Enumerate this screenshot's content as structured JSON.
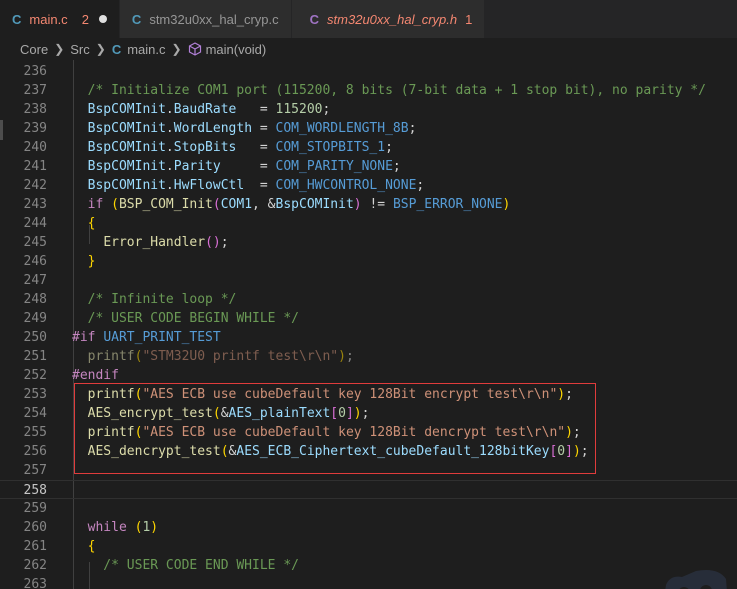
{
  "tabs": [
    {
      "icon": "C",
      "label": "main.c",
      "badge": "2",
      "dirty": true,
      "active": true
    },
    {
      "icon": "C",
      "label": "stm32u0xx_hal_cryp.c",
      "active": false
    },
    {
      "icon": "C",
      "label": "stm32u0xx_hal_cryp.h",
      "badge": "1",
      "active": false
    }
  ],
  "breadcrumb": {
    "items": [
      "Core",
      "Src",
      "main.c",
      "main(void)"
    ]
  },
  "editor": {
    "current_line": "258",
    "lines": [
      {
        "n": "236",
        "tokens": []
      },
      {
        "n": "237",
        "tokens": [
          {
            "t": "  /* Initialize COM1 port (115200, 8 bits (7-bit data + 1 stop bit), no parity */",
            "c": "cmt"
          }
        ]
      },
      {
        "n": "238",
        "tokens": [
          {
            "t": "  BspCOMInit",
            "c": "var"
          },
          {
            "t": "."
          },
          {
            "t": "BaudRate",
            "c": "var"
          },
          {
            "t": "   = "
          },
          {
            "t": "115200",
            "c": "num"
          },
          {
            "t": ";"
          }
        ]
      },
      {
        "n": "239",
        "tokens": [
          {
            "t": "  BspCOMInit",
            "c": "var"
          },
          {
            "t": "."
          },
          {
            "t": "WordLength",
            "c": "var"
          },
          {
            "t": " = "
          },
          {
            "t": "COM_WORDLENGTH_8B",
            "c": "mac"
          },
          {
            "t": ";"
          }
        ]
      },
      {
        "n": "240",
        "tokens": [
          {
            "t": "  BspCOMInit",
            "c": "var"
          },
          {
            "t": "."
          },
          {
            "t": "StopBits",
            "c": "var"
          },
          {
            "t": "   = "
          },
          {
            "t": "COM_STOPBITS_1",
            "c": "mac"
          },
          {
            "t": ";"
          }
        ]
      },
      {
        "n": "241",
        "tokens": [
          {
            "t": "  BspCOMInit",
            "c": "var"
          },
          {
            "t": "."
          },
          {
            "t": "Parity",
            "c": "var"
          },
          {
            "t": "     = "
          },
          {
            "t": "COM_PARITY_NONE",
            "c": "mac"
          },
          {
            "t": ";"
          }
        ]
      },
      {
        "n": "242",
        "tokens": [
          {
            "t": "  BspCOMInit",
            "c": "var"
          },
          {
            "t": "."
          },
          {
            "t": "HwFlowCtl",
            "c": "var"
          },
          {
            "t": "  = "
          },
          {
            "t": "COM_HWCONTROL_NONE",
            "c": "mac"
          },
          {
            "t": ";"
          }
        ]
      },
      {
        "n": "243",
        "tokens": [
          {
            "t": "  if",
            "c": "kc"
          },
          {
            "t": " "
          },
          {
            "t": "(",
            "c": "br1"
          },
          {
            "t": "BSP_COM_Init",
            "c": "fn"
          },
          {
            "t": "(",
            "c": "br2"
          },
          {
            "t": "COM1",
            "c": "var"
          },
          {
            "t": ", &"
          },
          {
            "t": "BspCOMInit",
            "c": "var"
          },
          {
            "t": ")",
            "c": "br2"
          },
          {
            "t": " != "
          },
          {
            "t": "BSP_ERROR_NONE",
            "c": "mac"
          },
          {
            "t": ")",
            "c": "br1"
          }
        ]
      },
      {
        "n": "244",
        "tokens": [
          {
            "t": "  "
          },
          {
            "t": "{",
            "c": "br1"
          }
        ]
      },
      {
        "n": "245",
        "tokens": [
          {
            "t": "    "
          },
          {
            "t": "Error_Handler",
            "c": "fn"
          },
          {
            "t": "(",
            "c": "br2"
          },
          {
            "t": ")",
            "c": "br2"
          },
          {
            "t": ";"
          }
        ]
      },
      {
        "n": "246",
        "tokens": [
          {
            "t": "  "
          },
          {
            "t": "}",
            "c": "br1"
          }
        ]
      },
      {
        "n": "247",
        "tokens": []
      },
      {
        "n": "248",
        "tokens": [
          {
            "t": "  /* Infinite loop */",
            "c": "cmt"
          }
        ]
      },
      {
        "n": "249",
        "tokens": [
          {
            "t": "  /* USER CODE BEGIN WHILE */",
            "c": "cmt"
          }
        ]
      },
      {
        "n": "250",
        "tokens": [
          {
            "t": "#if",
            "c": "kc"
          },
          {
            "t": " "
          },
          {
            "t": "UART_PRINT_TEST",
            "c": "mac"
          }
        ]
      },
      {
        "n": "251",
        "tokens": [
          {
            "t": "  printf",
            "c": "fn",
            "d": true
          },
          {
            "t": "(",
            "c": "br1",
            "d": true
          },
          {
            "t": "\"STM32U0 printf test\\r\\n\"",
            "c": "str",
            "d": true
          },
          {
            "t": ")",
            "c": "br1",
            "d": true
          },
          {
            "t": ";",
            "d": true
          }
        ]
      },
      {
        "n": "252",
        "tokens": [
          {
            "t": "#endif",
            "c": "kc"
          }
        ]
      },
      {
        "n": "253",
        "tokens": [
          {
            "t": "  printf",
            "c": "fn"
          },
          {
            "t": "(",
            "c": "br1"
          },
          {
            "t": "\"AES ECB use cubeDefault key 128Bit encrypt test\\r\\n\"",
            "c": "str"
          },
          {
            "t": ")",
            "c": "br1"
          },
          {
            "t": ";"
          }
        ]
      },
      {
        "n": "254",
        "tokens": [
          {
            "t": "  AES_encrypt_test",
            "c": "fn"
          },
          {
            "t": "(",
            "c": "br1"
          },
          {
            "t": "&"
          },
          {
            "t": "AES_plainText",
            "c": "var"
          },
          {
            "t": "[",
            "c": "br2"
          },
          {
            "t": "0",
            "c": "num"
          },
          {
            "t": "]",
            "c": "br2"
          },
          {
            "t": ")",
            "c": "br1"
          },
          {
            "t": ";"
          }
        ]
      },
      {
        "n": "255",
        "tokens": [
          {
            "t": "  printf",
            "c": "fn"
          },
          {
            "t": "(",
            "c": "br1"
          },
          {
            "t": "\"AES ECB use cubeDefault key 128Bit dencrypt test\\r\\n\"",
            "c": "str"
          },
          {
            "t": ")",
            "c": "br1"
          },
          {
            "t": ";"
          }
        ]
      },
      {
        "n": "256",
        "tokens": [
          {
            "t": "  AES_dencrypt_test",
            "c": "fn"
          },
          {
            "t": "(",
            "c": "br1"
          },
          {
            "t": "&"
          },
          {
            "t": "AES_ECB_Ciphertext_cubeDefault_128bitKey",
            "c": "var"
          },
          {
            "t": "[",
            "c": "br2"
          },
          {
            "t": "0",
            "c": "num"
          },
          {
            "t": "]",
            "c": "br2"
          },
          {
            "t": ")",
            "c": "br1"
          },
          {
            "t": ";"
          }
        ]
      },
      {
        "n": "257",
        "tokens": []
      },
      {
        "n": "258",
        "tokens": []
      },
      {
        "n": "259",
        "tokens": []
      },
      {
        "n": "260",
        "tokens": [
          {
            "t": "  while",
            "c": "kc"
          },
          {
            "t": " "
          },
          {
            "t": "(",
            "c": "br1"
          },
          {
            "t": "1",
            "c": "num"
          },
          {
            "t": ")",
            "c": "br1"
          }
        ]
      },
      {
        "n": "261",
        "tokens": [
          {
            "t": "  "
          },
          {
            "t": "{",
            "c": "br1"
          }
        ]
      },
      {
        "n": "262",
        "tokens": [
          {
            "t": "    /* USER CODE END WHILE */",
            "c": "cmt"
          }
        ]
      },
      {
        "n": "263",
        "tokens": []
      }
    ]
  }
}
